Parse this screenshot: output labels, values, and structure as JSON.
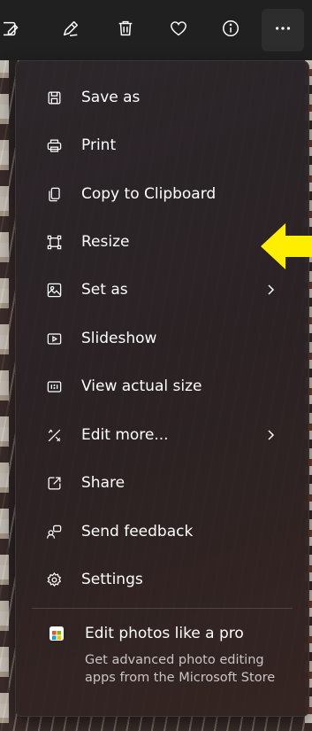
{
  "toolbar": {
    "buttons": [
      {
        "name": "edit-image-button",
        "icon": "edit-image-icon"
      },
      {
        "name": "draw-button",
        "icon": "pen-icon"
      },
      {
        "name": "delete-button",
        "icon": "trash-icon"
      },
      {
        "name": "favorite-button",
        "icon": "heart-icon"
      },
      {
        "name": "info-button",
        "icon": "info-icon"
      },
      {
        "name": "more-options-button",
        "icon": "more-icon",
        "label": "..."
      }
    ]
  },
  "menu": {
    "items": [
      {
        "label": "Save as",
        "icon": "save-icon",
        "submenu": false
      },
      {
        "label": "Print",
        "icon": "print-icon",
        "submenu": false
      },
      {
        "label": "Copy to Clipboard",
        "icon": "copy-icon",
        "submenu": false
      },
      {
        "label": "Resize",
        "icon": "resize-icon",
        "submenu": false
      },
      {
        "label": "Set as",
        "icon": "set-as-icon",
        "submenu": true
      },
      {
        "label": "Slideshow",
        "icon": "slideshow-icon",
        "submenu": false
      },
      {
        "label": "View actual size",
        "icon": "actual-size-icon",
        "submenu": false
      },
      {
        "label": "Edit more...",
        "icon": "edit-more-icon",
        "submenu": true
      },
      {
        "label": "Share",
        "icon": "share-icon",
        "submenu": false
      },
      {
        "label": "Send feedback",
        "icon": "feedback-icon",
        "submenu": false
      },
      {
        "label": "Settings",
        "icon": "gear-icon",
        "submenu": false
      }
    ],
    "promo": {
      "title": "Edit photos like a pro",
      "subtitle": "Get advanced photo editing apps from the Microsoft Store",
      "icon": "store-icon"
    }
  },
  "annotation": {
    "icon": "arrow-left-icon",
    "color": "#ffee00"
  },
  "colors": {
    "menu_bg": "#2b2427",
    "text": "#ffffff",
    "subtext": "#c9c5c6",
    "toolbar_bg": "#202020"
  }
}
